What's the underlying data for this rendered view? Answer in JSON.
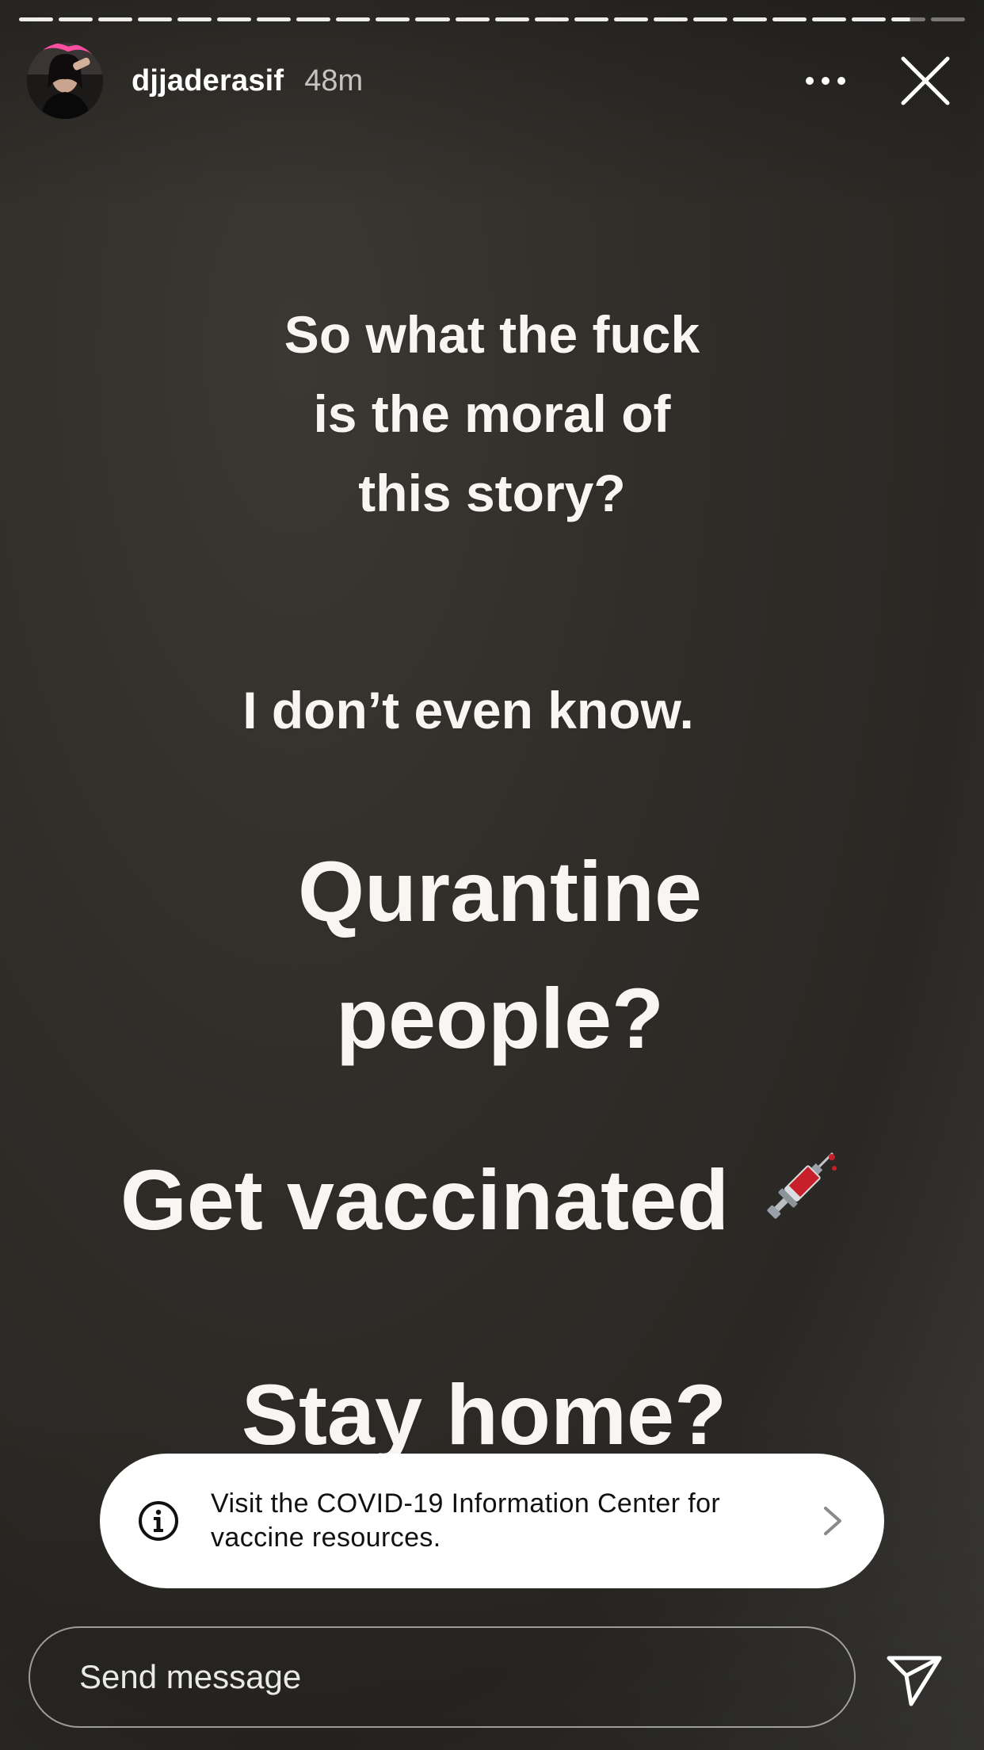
{
  "progress": {
    "segments": 24,
    "current_segment": 23,
    "current_fraction": 0.55
  },
  "header": {
    "username": "djjaderasif",
    "timestamp": "48m",
    "more_icon": "more-horizontal-icon",
    "close_icon": "close-icon"
  },
  "story": {
    "line1": "So what the fuck",
    "line2": "is the moral of",
    "line3": "this story?",
    "line4": "I don’t even know.",
    "line5": "Qurantine",
    "line6": "people?",
    "line7": "Get vaccinated",
    "emoji": "syringe-emoji",
    "line8": "Stay home?"
  },
  "covid_banner": {
    "icon": "info-icon",
    "line1": "Visit the COVID-19 Information Center for",
    "line2": "vaccine resources.",
    "chevron": "chevron-right-icon"
  },
  "footer": {
    "placeholder": "Send message",
    "send_icon": "send-icon"
  },
  "colors": {
    "background": "#2e2b27",
    "text": "#f7f6f3",
    "banner_bg": "#ffffff"
  }
}
